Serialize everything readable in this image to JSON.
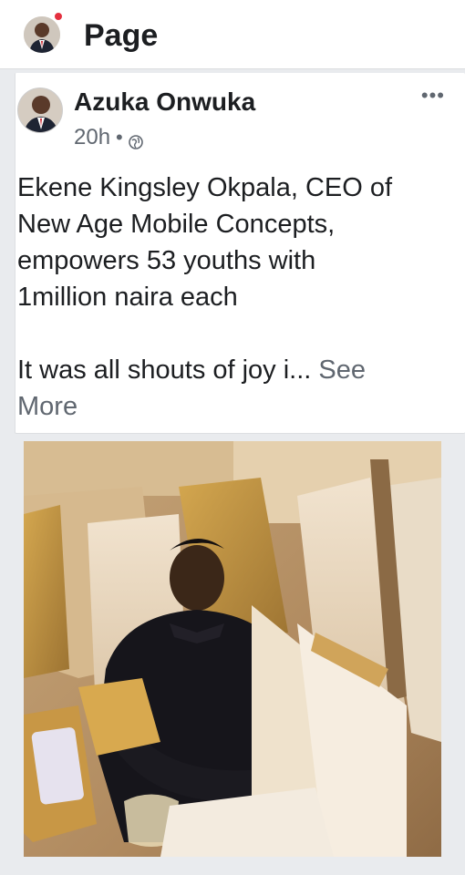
{
  "header": {
    "title": "Page"
  },
  "post": {
    "author": "Azuka Onwuka",
    "time": "20h",
    "separator": "•",
    "more_label": "•••",
    "text_lines": [
      "Ekene Kingsley Okpala, CEO of",
      "New Age Mobile Concepts,",
      "empowers 53 youths with",
      "1million naira each"
    ],
    "text_truncated": "It was all shouts of joy i...",
    "see_more": "See",
    "see_more_2": "More"
  },
  "colors": {
    "accent_dot": "#e4303f",
    "secondary_text": "#606770"
  },
  "icons": [
    "avatar",
    "notification-dot",
    "globe-icon",
    "more-options-icon"
  ]
}
